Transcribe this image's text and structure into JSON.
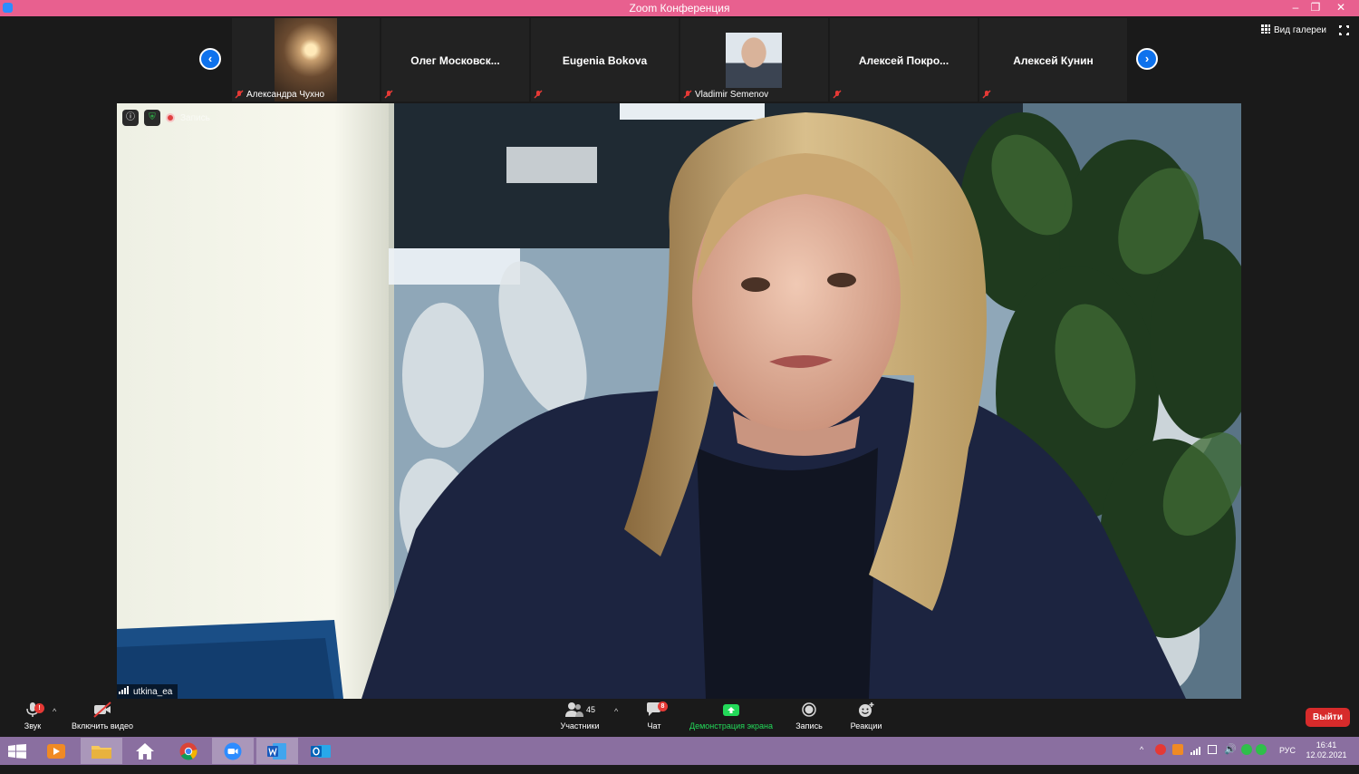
{
  "window": {
    "title": "Zoom Конференция"
  },
  "participants_strip": [
    {
      "name": "Александра Чухно",
      "has_video": true,
      "muted": true
    },
    {
      "name": "Олег  Московск...",
      "has_video": false,
      "muted": true
    },
    {
      "name": "Eugenia Bokova",
      "has_video": false,
      "muted": true
    },
    {
      "name": "Vladimir Semenov",
      "has_video": true,
      "muted": true
    },
    {
      "name": "Алексей  Покро...",
      "has_video": false,
      "muted": true
    },
    {
      "name": "Алексей Кунин",
      "has_video": false,
      "muted": true
    }
  ],
  "header": {
    "gallery_view_label": "Вид галереи"
  },
  "main_video": {
    "speaker_name": "utkina_ea",
    "recording_label": "Запись"
  },
  "toolbar": {
    "audio_label": "Звук",
    "video_label": "Включить видео",
    "participants_label": "Участники",
    "participants_count": "45",
    "chat_label": "Чат",
    "chat_badge": "8",
    "share_label": "Демонстрация экрана",
    "record_label": "Запись",
    "reactions_label": "Реакции",
    "leave_label": "Выйти",
    "audio_badge": "!"
  },
  "taskbar": {
    "language": "РУС",
    "time": "16:41",
    "date": "12.02.2021"
  },
  "colors": {
    "title_bar": "#e8608f",
    "accent_blue": "#0e72ed",
    "share_green": "#23d959",
    "leave_red": "#d72b2b",
    "taskbar": "#8a6fa0"
  }
}
